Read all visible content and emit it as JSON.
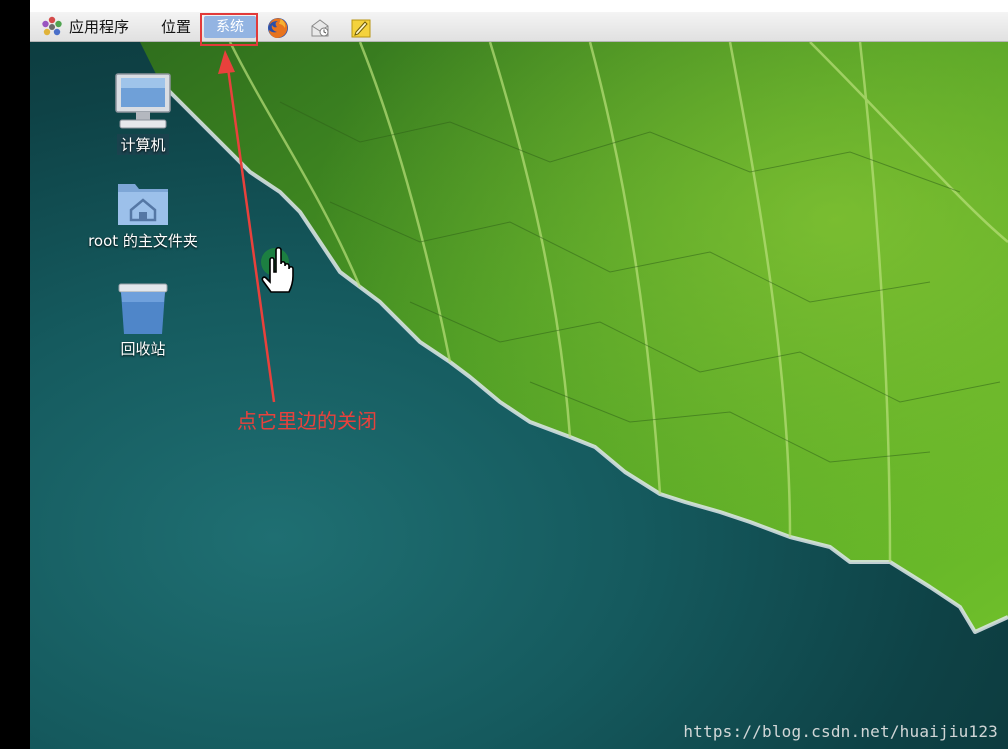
{
  "panel": {
    "apps_label": "应用程序",
    "places_label": "位置",
    "system_label": "系统",
    "launchers": [
      "firefox-icon",
      "mail-icon",
      "notes-icon"
    ]
  },
  "desktop_icons": [
    {
      "label": "计算机",
      "icon": "computer-icon"
    },
    {
      "label": "root 的主文件夹",
      "icon": "home-folder-icon"
    },
    {
      "label": "回收站",
      "icon": "trash-icon"
    }
  ],
  "annotation": {
    "text": "点它里边的关闭",
    "color": "#e8413c"
  },
  "watermark": "https://blog.csdn.net/huaijiu123"
}
